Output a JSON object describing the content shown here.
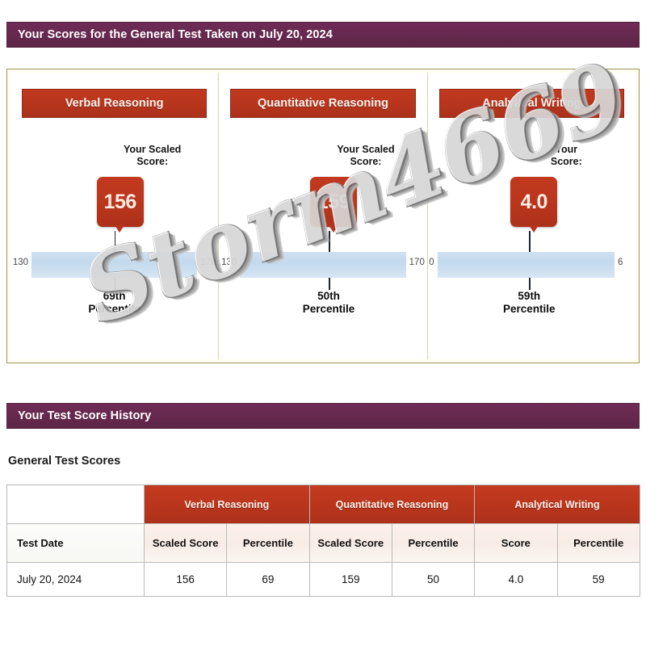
{
  "report": {
    "scores_header": "Your Scores for the General Test Taken on July 20, 2024",
    "history_header": "Your Test Score History",
    "general_scores_title": "General Test Scores"
  },
  "watermark": {
    "text": "Storm4669"
  },
  "sections": [
    {
      "title": "Verbal Reasoning",
      "caption": "Your Scaled\nScore:",
      "caption_line1": "Your Scaled",
      "caption_line2": "Score:",
      "score": "156",
      "scale_min": "130",
      "scale_max": "170",
      "percentile_line1": "69th",
      "percentile_line2": "Percentile"
    },
    {
      "title": "Quantitative Reasoning",
      "caption_line1": "Your Scaled",
      "caption_line2": "Score:",
      "score": "159",
      "scale_min": "130",
      "scale_max": "170",
      "percentile_line1": "50th",
      "percentile_line2": "Percentile"
    },
    {
      "title": "Analytical Writing",
      "caption_line1": "Your",
      "caption_line2": "Score:",
      "score": "4.0",
      "scale_min": "0",
      "scale_max": "6",
      "percentile_line1": "59th",
      "percentile_line2": "Percentile"
    }
  ],
  "table": {
    "group_headers": [
      "Verbal Reasoning",
      "Quantitative Reasoning",
      "Analytical Writing"
    ],
    "sub_headers": [
      "Test Date",
      "Scaled Score",
      "Percentile",
      "Scaled Score",
      "Percentile",
      "Score",
      "Percentile"
    ],
    "rows": [
      [
        "July 20, 2024",
        "156",
        "69",
        "159",
        "50",
        "4.0",
        "59"
      ]
    ]
  },
  "chart_data": {
    "type": "bar",
    "title": "Your Scores for the General Test Taken on July 20, 2024",
    "categories": [
      "Verbal Reasoning",
      "Quantitative Reasoning",
      "Analytical Writing"
    ],
    "series": [
      {
        "name": "Scaled Score",
        "values": [
          156,
          159,
          4.0
        ]
      },
      {
        "name": "Percentile",
        "values": [
          69,
          50,
          59
        ]
      }
    ],
    "axis_ranges": [
      [
        130,
        170
      ],
      [
        130,
        170
      ],
      [
        0,
        6
      ]
    ],
    "marker_positions_pct": [
      65.0,
      72.5,
      66.7
    ],
    "grid": false,
    "legend": "none",
    "xlabel": "",
    "ylabel": ""
  },
  "colors": {
    "purple_bar": "#67294f",
    "red_accent": "#b8351c",
    "range_bar_blue": "#c3d9ed",
    "card_bg": "#fffdf2",
    "card_border": "#9a9456"
  }
}
